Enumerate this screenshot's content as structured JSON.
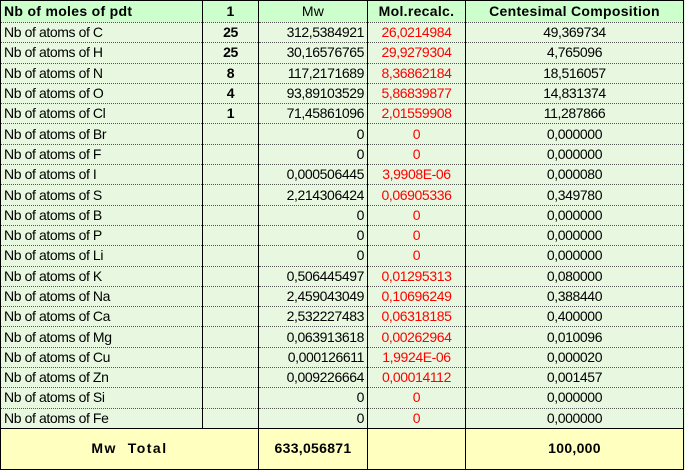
{
  "header": {
    "label": "Nb of moles of pdt",
    "moles": "1",
    "mw": "Mw",
    "molrecalc": "Mol.recalc.",
    "centesimal": "Centesimal Composition"
  },
  "rows": [
    {
      "label": "Nb of atoms of C",
      "n": "25",
      "mw": "312,5384921",
      "mol": "26,0214984",
      "cent": "49,369734"
    },
    {
      "label": "Nb of atoms of H",
      "n": "25",
      "mw": "30,16576765",
      "mol": "29,9279304",
      "cent": "4,765096"
    },
    {
      "label": "Nb of atoms of N",
      "n": "8",
      "mw": "117,2171689",
      "mol": "8,36862184",
      "cent": "18,516057"
    },
    {
      "label": "Nb of atoms of O",
      "n": "4",
      "mw": "93,89103529",
      "mol": "5,86839877",
      "cent": "14,831374"
    },
    {
      "label": "Nb of atoms of Cl",
      "n": "1",
      "mw": "71,45861096",
      "mol": "2,01559908",
      "cent": "11,287866"
    },
    {
      "label": "Nb of atoms of Br",
      "n": "",
      "mw": "0",
      "mol": "0",
      "cent": "0,000000"
    },
    {
      "label": "Nb of atoms of F",
      "n": "",
      "mw": "0",
      "mol": "0",
      "cent": "0,000000"
    },
    {
      "label": "Nb of atoms of I",
      "n": "",
      "mw": "0,000506445",
      "mol": "3,9908E-06",
      "cent": "0,000080"
    },
    {
      "label": "Nb of atoms of S",
      "n": "",
      "mw": "2,214306424",
      "mol": "0,06905336",
      "cent": "0,349780"
    },
    {
      "label": "Nb of atoms of B",
      "n": "",
      "mw": "0",
      "mol": "0",
      "cent": "0,000000"
    },
    {
      "label": "Nb of atoms of P",
      "n": "",
      "mw": "0",
      "mol": "0",
      "cent": "0,000000"
    },
    {
      "label": "Nb of atoms of Li",
      "n": "",
      "mw": "0",
      "mol": "0",
      "cent": "0,000000"
    },
    {
      "label": "Nb of atoms of K",
      "n": "",
      "mw": "0,506445497",
      "mol": "0,01295313",
      "cent": "0,080000"
    },
    {
      "label": "Nb of atoms of Na",
      "n": "",
      "mw": "2,459043049",
      "mol": "0,10696249",
      "cent": "0,388440"
    },
    {
      "label": "Nb of atoms of Ca",
      "n": "",
      "mw": "2,532227483",
      "mol": "0,06318185",
      "cent": "0,400000"
    },
    {
      "label": "Nb of atoms of Mg",
      "n": "",
      "mw": "0,063913618",
      "mol": "0,00262964",
      "cent": "0,010096"
    },
    {
      "label": "Nb of atoms of Cu",
      "n": "",
      "mw": "0,000126611",
      "mol": "1,9924E-06",
      "cent": "0,000020"
    },
    {
      "label": "Nb of atoms of Zn",
      "n": "",
      "mw": "0,009226664",
      "mol": "0,00014112",
      "cent": "0,001457"
    },
    {
      "label": "Nb of atoms of Si",
      "n": "",
      "mw": "0",
      "mol": "0",
      "cent": "0,000000"
    },
    {
      "label": "Nb of atoms of Fe",
      "n": "",
      "mw": "0",
      "mol": "0",
      "cent": "0,000000"
    }
  ],
  "total": {
    "label": "Mw  Total",
    "mw": "633,056871",
    "cent": "100,000"
  }
}
